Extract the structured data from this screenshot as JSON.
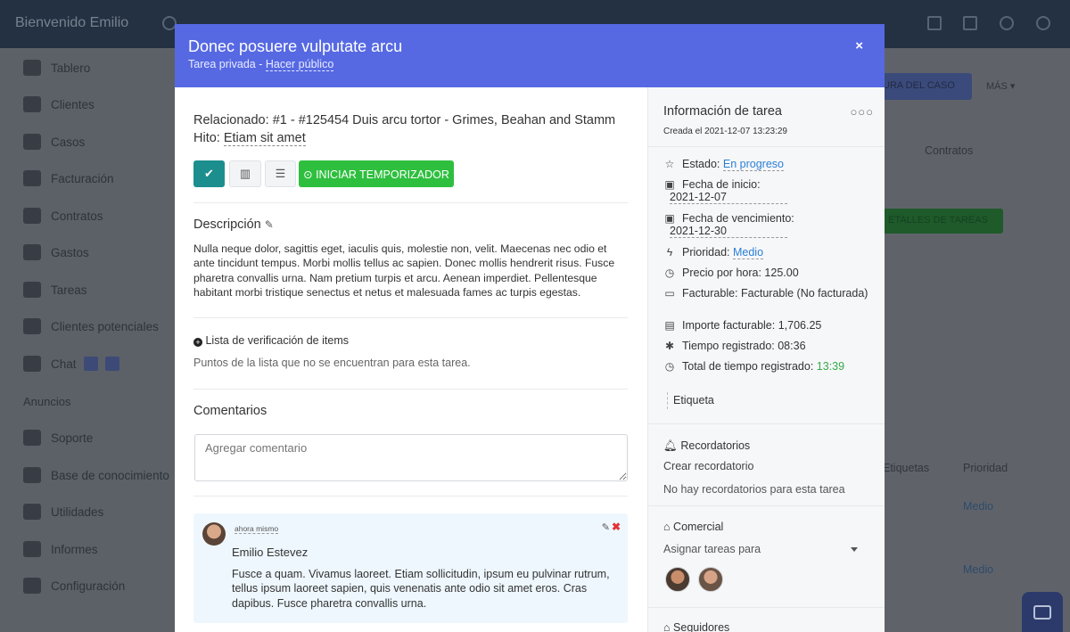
{
  "background": {
    "welcome": "Bienvenido Emilio",
    "sidebar": [
      {
        "label": "Tablero",
        "icon": "monitor-icon"
      },
      {
        "label": "Clientes",
        "icon": "address-card-icon"
      },
      {
        "label": "Casos",
        "icon": "list-icon"
      },
      {
        "label": "Facturación",
        "icon": "bank-icon"
      },
      {
        "label": "Contratos",
        "icon": "files-icon"
      },
      {
        "label": "Gastos",
        "icon": "receipt-icon"
      },
      {
        "label": "Tareas",
        "icon": "grid-icon"
      },
      {
        "label": "Clientes potenciales",
        "icon": "tty-icon"
      },
      {
        "label": "Chat",
        "icon": "chat-icon"
      }
    ],
    "anuncios": "Anuncios",
    "sidebar2": [
      {
        "label": "Soporte",
        "icon": "users-icon"
      },
      {
        "label": "Base de conocimiento",
        "icon": "folder-icon"
      },
      {
        "label": "Utilidades",
        "icon": "cogs-icon"
      },
      {
        "label": "Informes",
        "icon": "pie-chart-icon"
      },
      {
        "label": "Configuración",
        "icon": "gear-icon"
      }
    ],
    "main": {
      "btn_caso": "URA DEL CASO",
      "mas": "MÁS ▾",
      "contratos": "Contratos",
      "detalles": "ETALLES DE TAREAS",
      "etiquetas": "Etiquetas",
      "prioridad": "Prioridad",
      "medio1": "Medio",
      "medio2": "Medio"
    }
  },
  "modal": {
    "title": "Donec posuere vulputate arcu",
    "subtitle_prefix": "Tarea privada - ",
    "subtitle_link": "Hacer público",
    "close": "×",
    "related_label": "Relacionado:",
    "related_value": "#1 - #125454 Duis arcu tortor - Grimes, Beahan and Stamm",
    "milestone_label": "Hito:",
    "milestone_value": "Etiam sit amet",
    "buttons": {
      "check": "✔",
      "chart": "▥",
      "list": "☰",
      "timer": "⊙ INICIAR TEMPORIZADOR"
    },
    "description_title": "Descripción",
    "description_edit": "✎",
    "description": "Nulla neque dolor, sagittis eget, iaculis quis, molestie non, velit. Maecenas nec odio et ante tincidunt tempus. Morbi mollis tellus ac sapien. Donec mollis hendrerit risus. Fusce pharetra convallis urna. Nam pretium turpis et arcu. Aenean imperdiet. Pellentesque habitant morbi tristique senectus et netus et malesuada fames ac turpis egestas.",
    "checklist_title": "Lista de verificación de items",
    "checklist_empty": "Puntos de la lista que no se encuentran para esta tarea.",
    "comments_title": "Comentarios",
    "comment_placeholder": "Agregar comentario",
    "comment": {
      "time": "ahora mismo",
      "author": "Emilio Estevez",
      "text": "Fusce a quam. Vivamus laoreet. Etiam sollicitudin, ipsum eu pulvinar rutrum, tellus ipsum laoreet sapien, quis venenatis ante odio sit amet eros. Cras dapibus. Fusce pharetra convallis urna."
    }
  },
  "info": {
    "title": "Información de tarea",
    "menu": "○○○",
    "created": "Creada el 2021-12-07 13:23:29",
    "status_label": "Estado:",
    "status_value": "En progreso",
    "start_label": "Fecha de inicio:",
    "start_value": "2021-12-07",
    "due_label": "Fecha de vencimiento:",
    "due_value": "2021-12-30",
    "priority_label": "Prioridad:",
    "priority_value": "Medio",
    "hourly_label": "Precio por hora:",
    "hourly_value": "125.00",
    "billable_label": "Facturable:",
    "billable_value": "Facturable (No facturada)",
    "amount_label": "Importe facturable:",
    "amount_value": "1,706.25",
    "logged_label": "Tiempo registrado:",
    "logged_value": "08:36",
    "total_label": "Total de tiempo registrado:",
    "total_value": "13:39",
    "tag": "Etiqueta",
    "reminders_title": "Recordatorios",
    "create_reminder": "Crear recordatorio",
    "no_reminders": "No hay recordatorios para esta tarea",
    "commercial_title": "Comercial",
    "assign_placeholder": "Asignar tareas para",
    "followers_title": "Seguidores"
  },
  "colors": {
    "modal_header": "#5669e3",
    "accent_teal": "#1c8e8e",
    "timer_green": "#2fbf3f",
    "link_blue": "#2a7fd4"
  }
}
